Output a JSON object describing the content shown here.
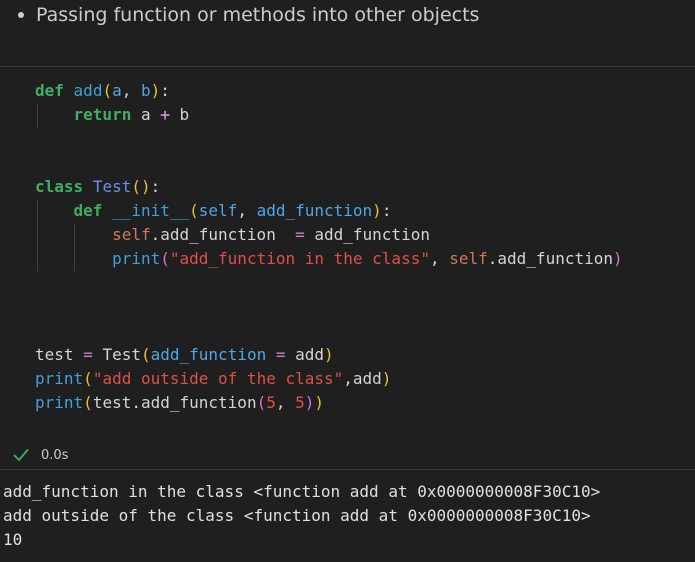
{
  "markdown": {
    "bullet_text": "Passing function or methods into other objects"
  },
  "code": {
    "lines": [
      [
        [
          "def",
          "def"
        ],
        [
          " ",
          "plain"
        ],
        [
          "add",
          "fn"
        ],
        [
          "(",
          "p1"
        ],
        [
          "a",
          "param"
        ],
        [
          ", ",
          "plain"
        ],
        [
          "b",
          "param"
        ],
        [
          ")",
          "p1"
        ],
        [
          ":",
          "plain"
        ]
      ],
      [
        [
          "    ",
          "plain"
        ],
        [
          "return",
          "def"
        ],
        [
          " a ",
          "plain"
        ],
        [
          "+",
          "op"
        ],
        [
          " b",
          "plain"
        ]
      ],
      [],
      [],
      [
        [
          "class",
          "def"
        ],
        [
          " ",
          "plain"
        ],
        [
          "Test",
          "cls2"
        ],
        [
          "()",
          "p1"
        ],
        [
          ":",
          "plain"
        ]
      ],
      [
        [
          "    ",
          "plain"
        ],
        [
          "def",
          "def"
        ],
        [
          " ",
          "plain"
        ],
        [
          "__init__",
          "fn"
        ],
        [
          "(",
          "p1"
        ],
        [
          "self",
          "param"
        ],
        [
          ", ",
          "plain"
        ],
        [
          "add_function",
          "param"
        ],
        [
          ")",
          "p1"
        ],
        [
          ":",
          "plain"
        ]
      ],
      [
        [
          "        ",
          "plain"
        ],
        [
          "self",
          "self"
        ],
        [
          ".add_function  ",
          "plain"
        ],
        [
          "=",
          "eq"
        ],
        [
          " add_function",
          "plain"
        ]
      ],
      [
        [
          "        ",
          "plain"
        ],
        [
          "print",
          "builtin"
        ],
        [
          "(",
          "p2"
        ],
        [
          "\"add_function in the class\"",
          "str"
        ],
        [
          ", ",
          "plain"
        ],
        [
          "self",
          "self"
        ],
        [
          ".add_function",
          "plain"
        ],
        [
          ")",
          "p2"
        ]
      ],
      [],
      [],
      [],
      [
        [
          "test",
          "plain"
        ],
        [
          " ",
          "plain"
        ],
        [
          "=",
          "eq"
        ],
        [
          " Test",
          "plain"
        ],
        [
          "(",
          "p1"
        ],
        [
          "add_function",
          "param"
        ],
        [
          " ",
          "plain"
        ],
        [
          "=",
          "eq"
        ],
        [
          " add",
          "plain"
        ],
        [
          ")",
          "p1"
        ]
      ],
      [
        [
          "print",
          "builtin"
        ],
        [
          "(",
          "p1"
        ],
        [
          "\"add outside of the class\"",
          "str"
        ],
        [
          ",add",
          "plain"
        ],
        [
          ")",
          "p1"
        ]
      ],
      [
        [
          "print",
          "builtin"
        ],
        [
          "(",
          "p1"
        ],
        [
          "test.add_function",
          "plain"
        ],
        [
          "(",
          "p2"
        ],
        [
          "5",
          "num"
        ],
        [
          ", ",
          "plain"
        ],
        [
          "5",
          "num"
        ],
        [
          ")",
          "p2"
        ],
        [
          ")",
          "p1"
        ]
      ]
    ]
  },
  "status": {
    "exec_time": "0.0s",
    "icon": "check-icon",
    "success_color": "#3fae62"
  },
  "output": {
    "lines": [
      "add_function in the class <function add at 0x0000000008F30C10>",
      "add outside of the class <function add at 0x0000000008F30C10>",
      "10"
    ]
  }
}
